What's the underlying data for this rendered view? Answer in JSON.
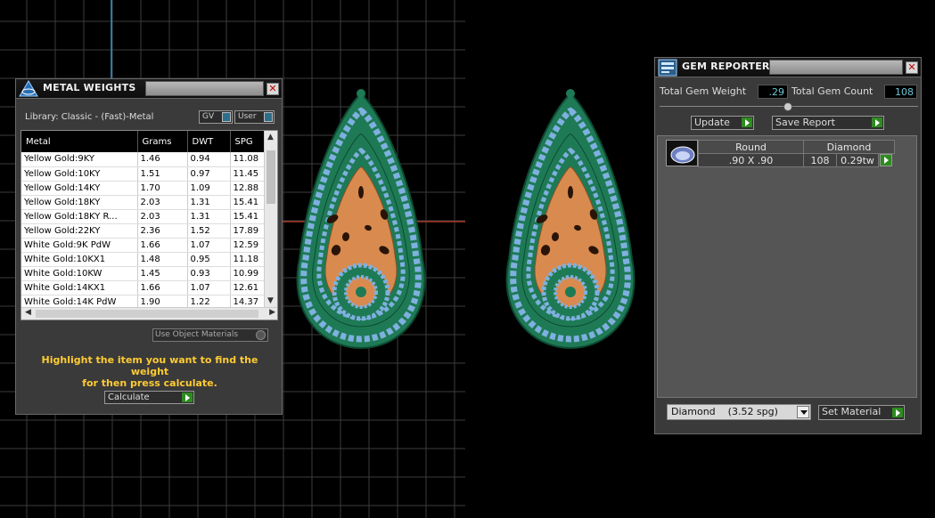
{
  "metal_panel": {
    "title": "METAL WEIGHTS",
    "library": "Library: Classic - (Fast)-Metal",
    "toggle_gv": "GV",
    "toggle_user": "User",
    "columns": [
      "Metal",
      "Grams",
      "DWT",
      "SPG"
    ],
    "rows": [
      [
        "Yellow Gold:9KY",
        "1.46",
        "0.94",
        "11.08"
      ],
      [
        "Yellow Gold:10KY",
        "1.51",
        "0.97",
        "11.45"
      ],
      [
        "Yellow Gold:14KY",
        "1.70",
        "1.09",
        "12.88"
      ],
      [
        "Yellow Gold:18KY",
        "2.03",
        "1.31",
        "15.41"
      ],
      [
        "Yellow Gold:18KY R...",
        "2.03",
        "1.31",
        "15.41"
      ],
      [
        "Yellow Gold:22KY",
        "2.36",
        "1.52",
        "17.89"
      ],
      [
        "White Gold:9K PdW",
        "1.66",
        "1.07",
        "12.59"
      ],
      [
        "White Gold:10KX1",
        "1.48",
        "0.95",
        "11.18"
      ],
      [
        "White Gold:10KW",
        "1.45",
        "0.93",
        "10.99"
      ],
      [
        "White Gold:14KX1",
        "1.66",
        "1.07",
        "12.61"
      ],
      [
        "White Gold:14K PdW",
        "1.90",
        "1.22",
        "14.37"
      ]
    ],
    "use_object_materials": "Use Object Materials",
    "instruction_line1": "Highlight the item you want to find the weight",
    "instruction_line2": "for then press calculate.",
    "calculate_label": "Calculate"
  },
  "gem_panel": {
    "title": "GEM REPORTER",
    "total_gem_weight_label": "Total Gem Weight",
    "total_gem_weight_value": ".29",
    "total_gem_count_label": "Total Gem Count",
    "total_gem_count_value": "108",
    "update_label": "Update",
    "save_report_label": "Save Report",
    "gem_row": {
      "shape": "Round",
      "material": "Diamond",
      "size": ".90 X .90",
      "count": "108",
      "weight": "0.29tw"
    },
    "material_select": "Diamond    (3.52 spg)",
    "set_material_label": "Set Material"
  },
  "colors": {
    "gem_value_text": "#6cc6d6",
    "instruction_text": "#ffcc33",
    "go_button": "#2e8b20",
    "earring_gem_blue": "#7fb0e0",
    "earring_gem_green": "#1e7a55",
    "earring_metal": "#d98a4e"
  }
}
